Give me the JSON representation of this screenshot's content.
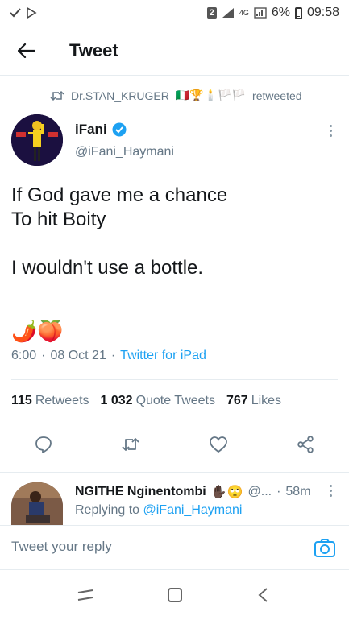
{
  "status_bar": {
    "sim": "2",
    "network": "4G",
    "battery": "6%",
    "time": "09:58"
  },
  "header": {
    "title": "Tweet"
  },
  "retweet_context": {
    "name": "Dr.STAN_KRUGER",
    "emojis": "🇮🇹🏆🕯️🏳️🏳️",
    "suffix": "retweeted"
  },
  "tweet": {
    "author_name": "iFani",
    "author_handle": "@iFani_Haymani",
    "verified": true,
    "text": "If God gave me a chance\nTo hit Boity\n\nI wouldn't use a bottle.",
    "emojis": "🌶️🍑",
    "time": "6:00",
    "date": "08 Oct 21",
    "source": "Twitter for iPad",
    "separator": "·"
  },
  "stats": {
    "retweets_count": "115",
    "retweets_label": "Retweets",
    "quotes_count": "1 032",
    "quotes_label": "Quote Tweets",
    "likes_count": "767",
    "likes_label": "Likes"
  },
  "reply": {
    "author_name": "NGITHE Nginentombi",
    "emojis": "✋🏿🙄",
    "handle": "@...",
    "time": "58m",
    "separator": "·",
    "replying_to_label": "Replying to",
    "replying_to_handle": "@iFani_Haymani"
  },
  "compose": {
    "placeholder": "Tweet your reply"
  },
  "colors": {
    "accent": "#1da1f2",
    "text_primary": "#14171a",
    "text_secondary": "#657786",
    "divider": "#e6ecf0"
  }
}
